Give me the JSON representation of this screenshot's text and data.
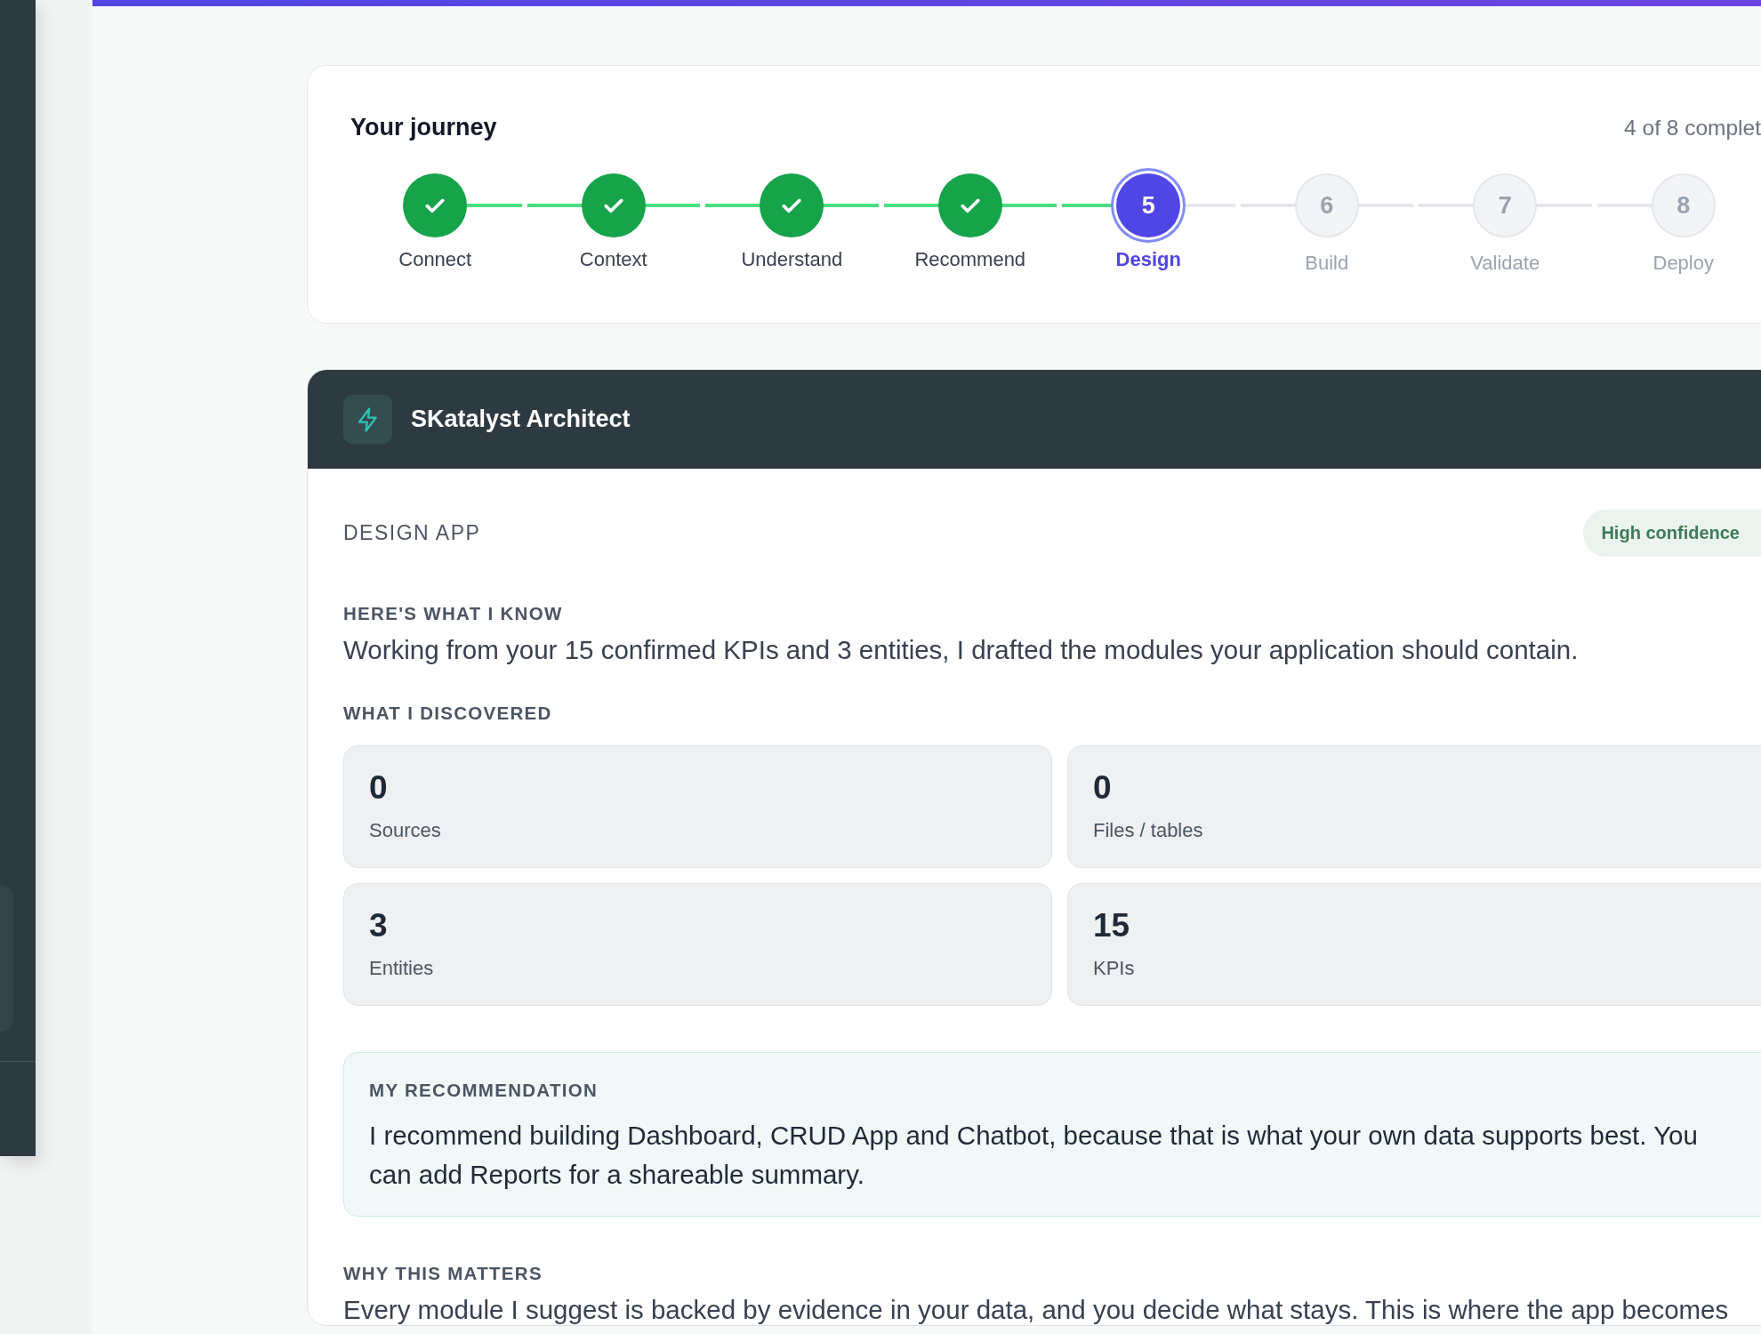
{
  "journey": {
    "title": "Your journey",
    "progress": "4 of 8 complet",
    "steps": [
      {
        "label": "Connect",
        "completed": true,
        "selected": false
      },
      {
        "label": "Context",
        "completed": true,
        "selected": false
      },
      {
        "label": "Understand",
        "completed": true,
        "selected": false
      },
      {
        "label": "Recommend",
        "completed": true,
        "selected": false
      },
      {
        "label": "Design",
        "completed": false,
        "selected": true,
        "number": "5"
      },
      {
        "label": "Build",
        "completed": false,
        "selected": false,
        "number": "6"
      },
      {
        "label": "Validate",
        "completed": false,
        "selected": false,
        "number": "7"
      },
      {
        "label": "Deploy",
        "completed": false,
        "selected": false,
        "number": "8"
      }
    ]
  },
  "assistant": {
    "title": "SKatalyst Architect",
    "heading": "DESIGN APP",
    "badge": "High confidence",
    "sections": [
      {
        "kind": "text",
        "title": "HERE'S WHAT I KNOW",
        "text": "Working from your 15 confirmed KPIs and 3 entities, I drafted the modules your application should contain."
      },
      {
        "kind": "stats",
        "title": "WHAT I DISCOVERED",
        "stats": [
          {
            "value": "0",
            "label": "Sources"
          },
          {
            "value": "0",
            "label": "Files / tables"
          },
          {
            "value": "3",
            "label": "Entities"
          },
          {
            "value": "15",
            "label": "KPIs"
          }
        ]
      },
      {
        "kind": "callout",
        "title": "MY RECOMMENDATION",
        "text": "I recommend building Dashboard, CRUD App and Chatbot, because that is what your own data supports best. You can add Reports for a shareable summary."
      },
      {
        "kind": "text",
        "title": "WHY THIS MATTERS",
        "text": "Every module I suggest is backed by evidence in your data, and you decide what stays. This is where the app becomes"
      }
    ]
  }
}
